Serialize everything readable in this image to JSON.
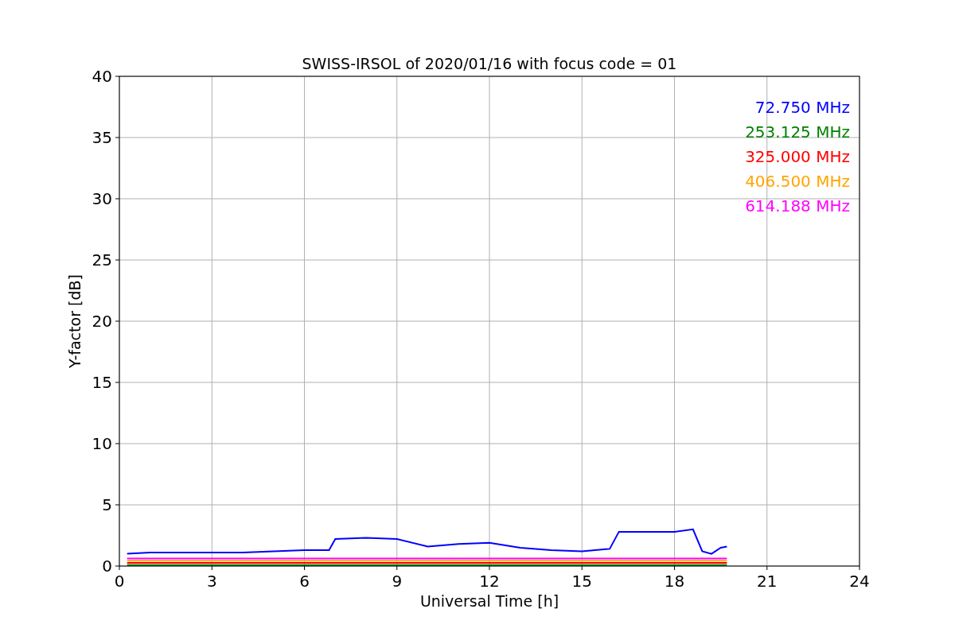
{
  "figure": {
    "chart_data": {
      "type": "line",
      "title": "SWISS-IRSOL of 2020/01/16 with focus code = 01",
      "xlabel": "Universal Time [h]",
      "ylabel": "Y-factor [dB]",
      "x": [
        0.25,
        1,
        2,
        3,
        4,
        5,
        6,
        6.8,
        7,
        8,
        9,
        10,
        11,
        12,
        13,
        14,
        15,
        15.9,
        16.2,
        17,
        18,
        18.6,
        18.9,
        19.2,
        19.5,
        19.7
      ],
      "series": [
        {
          "name": "72.750 MHz",
          "color": "#0000ff",
          "values": [
            1.0,
            1.1,
            1.1,
            1.1,
            1.1,
            1.2,
            1.3,
            1.3,
            2.2,
            2.3,
            2.2,
            1.6,
            1.8,
            1.9,
            1.5,
            1.3,
            1.2,
            1.4,
            2.8,
            2.8,
            2.8,
            3.0,
            1.2,
            1.0,
            1.5,
            1.6
          ]
        },
        {
          "name": "253.125 MHz",
          "color": "#008000",
          "values": [
            0.08,
            0.08,
            0.08,
            0.08,
            0.08,
            0.08,
            0.08,
            0.08,
            0.08,
            0.08,
            0.08,
            0.08,
            0.08,
            0.08,
            0.08,
            0.08,
            0.08,
            0.08,
            0.08,
            0.08,
            0.08,
            0.08,
            0.08,
            0.08,
            0.08,
            0.08
          ]
        },
        {
          "name": "325.000 MHz",
          "color": "#ff0000",
          "values": [
            0.26,
            0.26,
            0.26,
            0.26,
            0.26,
            0.26,
            0.26,
            0.26,
            0.26,
            0.26,
            0.26,
            0.26,
            0.26,
            0.26,
            0.26,
            0.26,
            0.26,
            0.26,
            0.26,
            0.26,
            0.26,
            0.26,
            0.26,
            0.26,
            0.26,
            0.26
          ]
        },
        {
          "name": "406.500 MHz",
          "color": "#ffa500",
          "values": [
            0.44,
            0.44,
            0.44,
            0.44,
            0.44,
            0.44,
            0.44,
            0.44,
            0.44,
            0.44,
            0.44,
            0.44,
            0.44,
            0.44,
            0.44,
            0.44,
            0.44,
            0.44,
            0.44,
            0.44,
            0.44,
            0.44,
            0.44,
            0.44,
            0.44,
            0.44
          ]
        },
        {
          "name": "614.188 MHz",
          "color": "#ff00ff",
          "values": [
            0.62,
            0.62,
            0.62,
            0.62,
            0.62,
            0.62,
            0.62,
            0.62,
            0.62,
            0.62,
            0.62,
            0.62,
            0.62,
            0.62,
            0.62,
            0.62,
            0.62,
            0.62,
            0.62,
            0.62,
            0.62,
            0.62,
            0.62,
            0.62,
            0.62,
            0.62
          ]
        }
      ],
      "xlim": [
        0,
        24
      ],
      "ylim": [
        0,
        40
      ],
      "xticks": [
        0,
        3,
        6,
        9,
        12,
        15,
        18,
        21,
        24
      ],
      "yticks": [
        0,
        5,
        10,
        15,
        20,
        25,
        30,
        35,
        40
      ],
      "grid": true
    }
  }
}
